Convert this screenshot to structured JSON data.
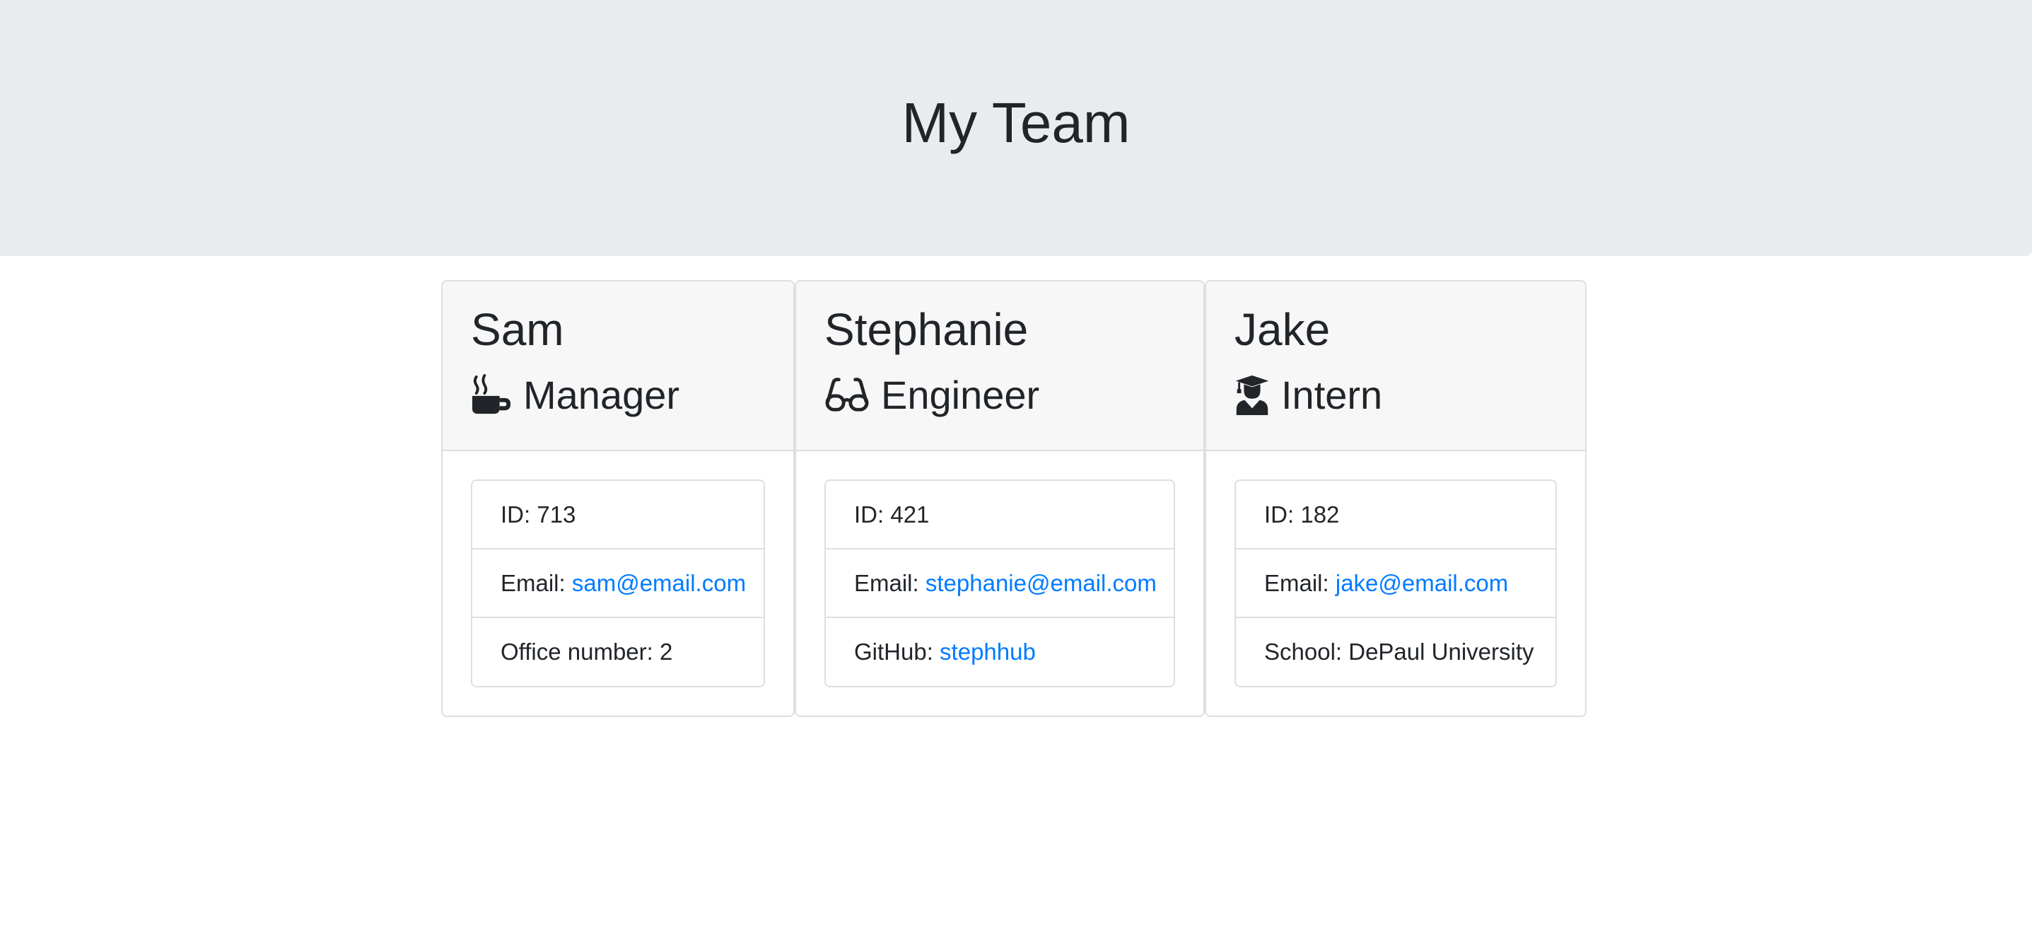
{
  "page": {
    "title": "My Team"
  },
  "cards": [
    {
      "name": "Sam",
      "role": "Manager",
      "icon": "mug-hot-icon",
      "id_label": "ID: 713",
      "email_label": "Email: ",
      "email": "sam@email.com",
      "extra_label": "Office number: 2",
      "extra_link": ""
    },
    {
      "name": "Stephanie",
      "role": "Engineer",
      "icon": "glasses-icon",
      "id_label": "ID: 421",
      "email_label": "Email: ",
      "email": "stephanie@email.com",
      "extra_label": "GitHub: ",
      "extra_link": "stephhub"
    },
    {
      "name": "Jake",
      "role": "Intern",
      "icon": "user-graduate-icon",
      "id_label": "ID: 182",
      "email_label": "Email: ",
      "email": "jake@email.com",
      "extra_label": "School: DePaul University",
      "extra_link": ""
    }
  ],
  "colors": {
    "header_bg": "#e9ecef",
    "card_header_bg": "#f7f7f7",
    "link": "#007bff",
    "text": "#212529"
  }
}
